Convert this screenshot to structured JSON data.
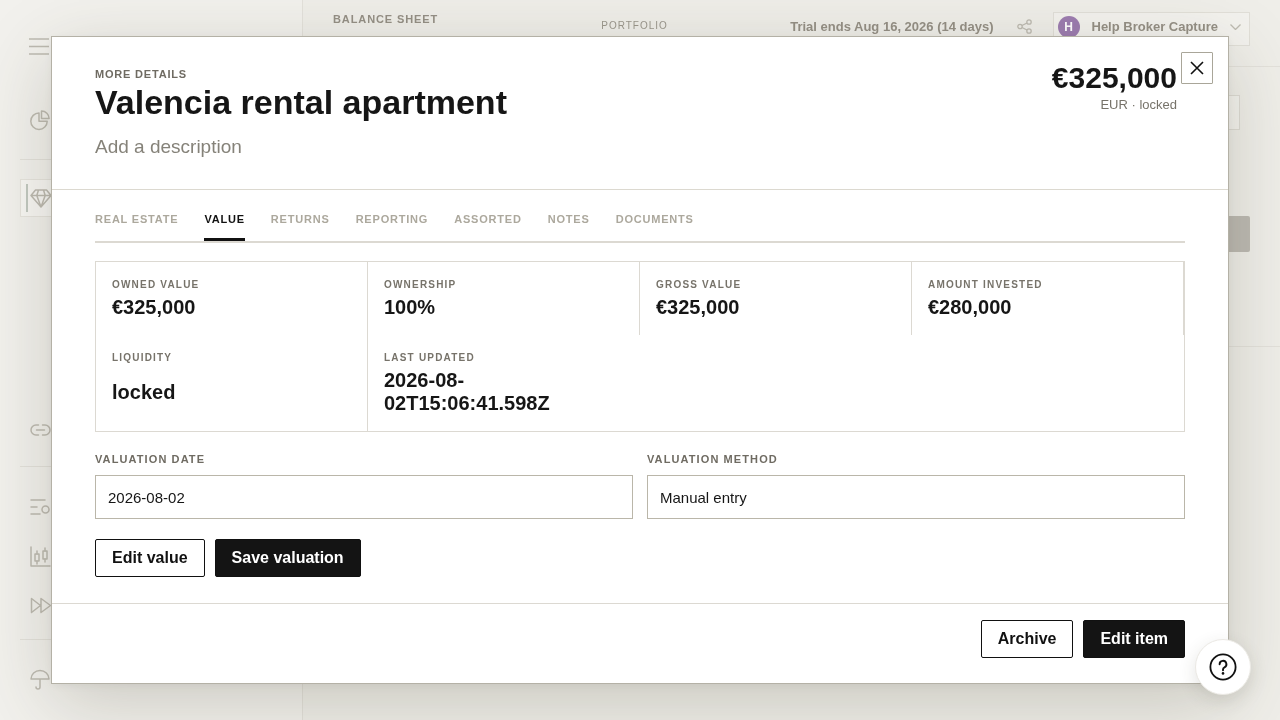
{
  "background": {
    "header": {
      "section_label": "BALANCE SHEET",
      "portfolio_label": "PORTFOLIO",
      "trial_notice": "Trial ends Aug 16, 2026 (14 days)",
      "account": {
        "initial": "H",
        "name": "Help Broker Capture"
      }
    },
    "sidebar": {
      "items": [
        {
          "selected": false
        },
        {
          "selected": true
        },
        {
          "selected": false
        },
        {
          "selected": false
        },
        {
          "selected": false
        },
        {
          "selected": false
        },
        {
          "selected": false
        }
      ]
    }
  },
  "modal": {
    "eyebrow": "MORE DETAILS",
    "title": "Valencia rental apartment",
    "description": {
      "placeholder": "Add a description"
    },
    "amount": "€325,000",
    "amount_note": "EUR · locked",
    "tabs": [
      {
        "label": "REAL ESTATE",
        "selected": false
      },
      {
        "label": "VALUE",
        "selected": true
      },
      {
        "label": "RETURNS",
        "selected": false
      },
      {
        "label": "REPORTING",
        "selected": false
      },
      {
        "label": "ASSORTED",
        "selected": false
      },
      {
        "label": "NOTES",
        "selected": false
      },
      {
        "label": "DOCUMENTS",
        "selected": false
      }
    ],
    "stats": [
      {
        "label": "OWNED VALUE",
        "value": "€325,000"
      },
      {
        "label": "OWNERSHIP",
        "value": "100%"
      },
      {
        "label": "GROSS VALUE",
        "value": "€325,000"
      },
      {
        "label": "AMOUNT INVESTED",
        "value": "€280,000"
      },
      {
        "label": "LIQUIDITY",
        "value": "locked"
      },
      {
        "label": "LAST UPDATED",
        "value": "2026-08-02T15:06:41.598Z"
      }
    ],
    "fields": [
      {
        "label": "VALUATION DATE",
        "value": "2026-08-02"
      },
      {
        "label": "VALUATION METHOD",
        "value": "Manual entry"
      }
    ],
    "actions": [
      {
        "label": "Edit value",
        "kind": "secondary"
      },
      {
        "label": "Save valuation",
        "kind": "primary"
      }
    ],
    "footer_actions": [
      {
        "label": "Archive",
        "kind": "secondary"
      },
      {
        "label": "Edit item",
        "kind": "primary"
      }
    ]
  }
}
